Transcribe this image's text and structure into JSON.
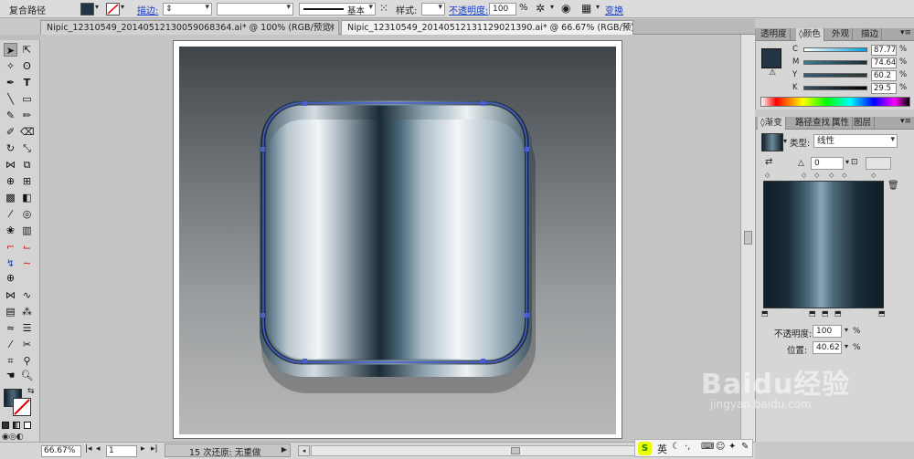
{
  "control_bar": {
    "label": "复合路径",
    "stroke_label": "描边:",
    "stroke_profile": "基本",
    "style_label": "样式:",
    "opacity_label": "不透明度:",
    "opacity_value": "100",
    "opacity_unit": "%",
    "transform_label": "变换"
  },
  "tabs": [
    {
      "label": "Nipic_12310549_20140512130059068364.ai* @ 100% (RGB/预览)"
    },
    {
      "label": "Nipic_12310549_20140512131129021390.ai* @ 66.67% (RGB/预览)"
    }
  ],
  "status_bar": {
    "zoom": "66.67%",
    "page": "1",
    "undo_text": "15 次还原: 无重做"
  },
  "color_panel": {
    "tabs": [
      "透明度",
      "颜色",
      "外观",
      "描边"
    ],
    "channels": [
      {
        "label": "C",
        "value": "87.77"
      },
      {
        "label": "M",
        "value": "74.64"
      },
      {
        "label": "Y",
        "value": "60.2"
      },
      {
        "label": "K",
        "value": "29.5"
      }
    ],
    "unit": "%",
    "fill_color": "#253444"
  },
  "gradient_panel": {
    "tabs": [
      "渐变",
      "路径查找",
      "属性",
      "图层"
    ],
    "type_label": "类型:",
    "type_value": "线性",
    "angle_value": "0",
    "opacity_label": "不透明度:",
    "opacity_value": "100",
    "location_label": "位置:",
    "location_value": "40.62",
    "unit": "%"
  },
  "ime_bar": {
    "lang": "英"
  },
  "watermark": {
    "brand": "Baidu经验",
    "url": "jingyan.baidu.com"
  },
  "colors": {
    "accent_link": "#1a3fc5",
    "selection_blue": "#4a5fd6",
    "gradient_dark": "#0f1e28",
    "gradient_light": "#f3f6f8"
  }
}
